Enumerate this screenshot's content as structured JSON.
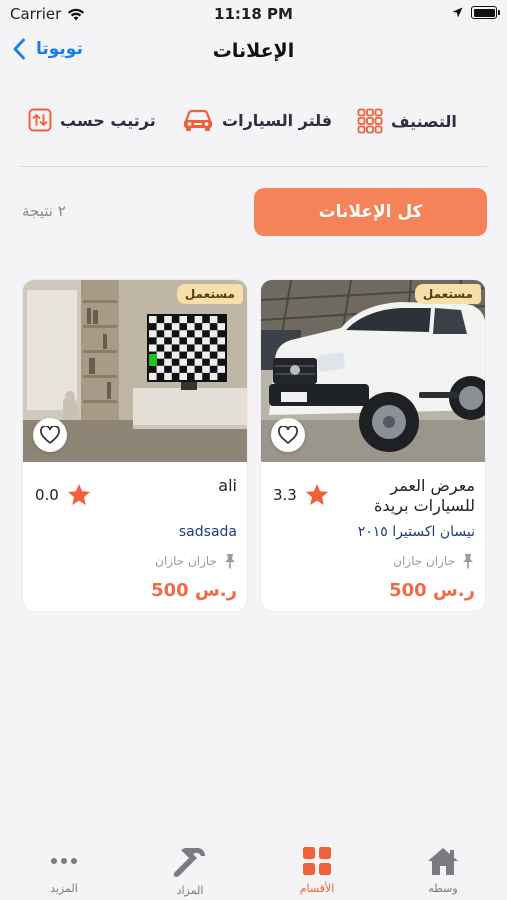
{
  "status": {
    "carrier": "Carrier",
    "time": "11:18 PM"
  },
  "nav": {
    "back_label": "تويوتا",
    "title": "الإعلانات"
  },
  "toolbar": {
    "sort_label": "ترتيب حسب",
    "filter_label": "فلتر السيارات",
    "category_label": "التصنيف"
  },
  "actions": {
    "all_ads_label": "كل الإعلانات",
    "result_count": "٢ نتيجة"
  },
  "cards": [
    {
      "badge": "مستعمل",
      "seller": "معرض العمر للسيارات بريدة",
      "rating": "3.3",
      "model": "نيسان اكستيرا ٢٠١٥",
      "location": "جازان جازان",
      "price": "500 ر.س"
    },
    {
      "badge": "مستعمل",
      "seller": "ali",
      "rating": "0.0",
      "model": "sadsada",
      "location": "جازان جازان",
      "price": "500 ر.س"
    }
  ],
  "tabs": [
    {
      "label": "وسطه",
      "icon": "home-icon"
    },
    {
      "label": "الأقسام",
      "icon": "grid-icon",
      "active": true
    },
    {
      "label": "المزاد",
      "icon": "hammer-icon"
    },
    {
      "label": "المزيد",
      "icon": "more-icon"
    }
  ],
  "colors": {
    "accent": "#f5835a",
    "price": "#ef6b45",
    "link": "#1a7cf5",
    "active_tab": "#f0603a",
    "badge_bg": "#f7dfaa"
  }
}
